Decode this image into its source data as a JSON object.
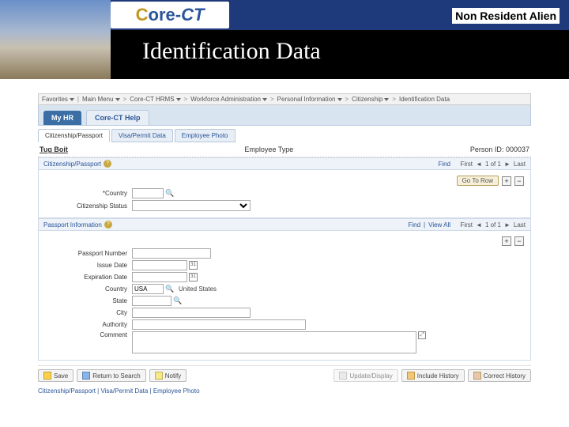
{
  "header": {
    "top_label": "Non Resident Alien",
    "title": "Identification Data",
    "logo": {
      "c": "C",
      "ore": "ore-",
      "ct": "CT"
    }
  },
  "breadcrumb": {
    "favorites": "Favorites",
    "main_menu": "Main Menu",
    "items": [
      "Core-CT HRMS",
      "Workforce Administration",
      "Personal Information",
      "Citizenship",
      "Identification Data"
    ]
  },
  "header_tabs": {
    "my_hr": "My HR",
    "help": "Core-CT Help"
  },
  "page_tabs": {
    "citizenship": "Citizenship/Passport",
    "visa": "Visa/Permit Data",
    "photo": "Employee Photo"
  },
  "employee": {
    "name": "Tug Boit",
    "type_label": "Employee Type",
    "person_id_label": "Person ID:",
    "person_id": "000037"
  },
  "citizenship_section": {
    "title": "Citizenship/Passport",
    "find": "Find",
    "first": "First",
    "page": "1 of 1",
    "last": "Last",
    "gotorow": "Go To Row",
    "country_label": "Country",
    "status_label": "Citizenship Status"
  },
  "passport_section": {
    "title": "Passport Information",
    "find": "Find",
    "viewall": "View All",
    "first": "First",
    "page": "1 of 1",
    "last": "Last",
    "number_label": "Passport Number",
    "issue_label": "Issue Date",
    "exp_label": "Expiration Date",
    "country_label": "Country",
    "country_value": "USA",
    "country_text": "United States",
    "state_label": "State",
    "city_label": "City",
    "authority_label": "Authority",
    "comment_label": "Comment"
  },
  "actions": {
    "save": "Save",
    "return": "Return to Search",
    "notify": "Notify",
    "update": "Update/Display",
    "include": "Include History",
    "correct": "Correct History"
  },
  "bottom_links": "Citizenship/Passport | Visa/Permit Data | Employee Photo"
}
